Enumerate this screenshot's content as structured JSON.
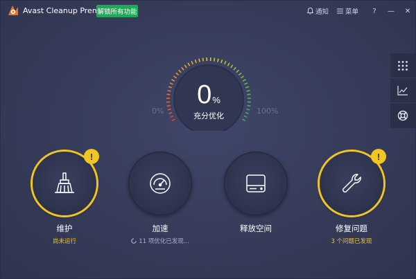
{
  "app": {
    "title": "Avast Cleanup Premium",
    "unlock_label": "解锁所有功能",
    "brand_color": "#f47216",
    "accent_green": "#1fa855"
  },
  "titlebar": {
    "notifications_label": "通知",
    "menu_label": "菜单",
    "help_label": "?",
    "minimize_label": "—",
    "close_label": "✕"
  },
  "rail": {
    "items": [
      {
        "icon": "grid-icon"
      },
      {
        "icon": "chart-icon"
      },
      {
        "icon": "lifebuoy-icon"
      }
    ]
  },
  "gauge": {
    "value": "0",
    "unit": "%",
    "caption": "充分优化",
    "min_label": "0%",
    "max_label": "100%",
    "level": 0
  },
  "tiles": [
    {
      "title": "维护",
      "subtitle": "尚未运行",
      "icon": "broom-icon",
      "warning": true
    },
    {
      "title": "加速",
      "subtitle": "11 项优化已发现...",
      "icon": "speedometer-icon",
      "warning": false
    },
    {
      "title": "释放空间",
      "subtitle": "",
      "icon": "hard-drive-icon",
      "warning": false
    },
    {
      "title": "修复问题",
      "subtitle": "3 个问题已发现",
      "icon": "wrench-icon",
      "warning": true
    }
  ],
  "colors": {
    "warning": "#f3c51f",
    "background": "#3a3f5c",
    "rail": "#2b3049"
  }
}
